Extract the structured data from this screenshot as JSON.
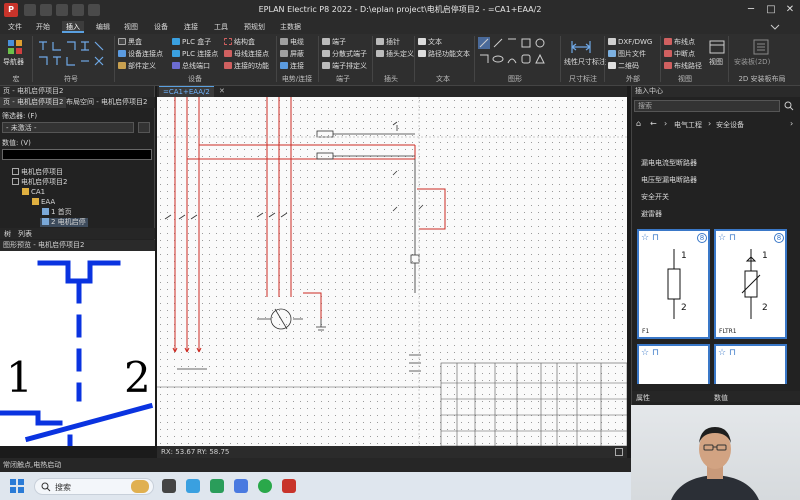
{
  "window": {
    "title": "EPLAN Electric P8 2022 - D:\\eplan project\\电机启停项目2 - =CA1+EAA/2",
    "minimize": "─",
    "maximize": "□",
    "close": "✕"
  },
  "app_icon_letter": "P",
  "menu": [
    "文件",
    "开始",
    "插入",
    "编辑",
    "视图",
    "设备",
    "连接",
    "工具",
    "预规划",
    "主数据"
  ],
  "menu_active": "插入",
  "ribbon": {
    "navigator": "导航器",
    "groups": {
      "macro": "宏",
      "symbol": "符号",
      "device": "设备",
      "potential": "电势/连接",
      "terminal": "端子",
      "plug": "插头",
      "text": "文本",
      "graphic": "图形",
      "dimension": "尺寸标注",
      "external": "外部",
      "view": "视图",
      "install_2d": "2D 安装板布局"
    },
    "device_col1": [
      "黑盒",
      "设备连接点",
      "部件定义"
    ],
    "device_col2": [
      "PLC 盒子",
      "PLC 连接点",
      "总线端口"
    ],
    "device_col3": [
      "结构盒",
      "母线连接点",
      "连接的功能"
    ],
    "potential": [
      "电缆",
      "屏蔽",
      "连接"
    ],
    "terminal": [
      "端子",
      "分散式端子",
      "端子排定义"
    ],
    "plug": [
      "插针",
      "插头定义"
    ],
    "text": [
      "文本",
      "路径功能文本"
    ],
    "dimension": "线性尺寸标注",
    "external": [
      "DXF/DWG",
      "图片文件",
      "二维码"
    ],
    "view_items": [
      "布线点",
      "中断点",
      "布线路径"
    ],
    "view": "视图",
    "install_2d": "安装板(2D)"
  },
  "left_panel": {
    "title": "页 - 电机启停项目2",
    "tabs": [
      "页 - 电机启停项目2",
      "布局空间 - 电机启停项目2"
    ],
    "filter_label": "筛选器: (F)",
    "filter_value": "- 未激活 -",
    "value_label": "数值: (V)",
    "tree": [
      "电机启停项目",
      "电机启停项目2",
      "CA1",
      "EAA",
      "1 首页",
      "2 电机启停"
    ],
    "bottom_tabs": [
      "树",
      "列表"
    ],
    "preview_title": "图形预览 - 电机启停项目2",
    "preview_labels": {
      "left": "1",
      "right": "2"
    }
  },
  "document_tab": "=CA1+EAA/2",
  "status": {
    "rx": "RX: 53.67",
    "ry": "RY: 58.75"
  },
  "right_panel": {
    "title": "插入中心",
    "search_placeholder": "搜索",
    "breadcrumb": [
      "电气工程",
      "安全设备"
    ],
    "categories": [
      "漏电电流型断路器",
      "电压型漏电断路器",
      "安全开关",
      "避雷器"
    ],
    "tiles": [
      {
        "name": "F1",
        "num_top": "1",
        "num_bottom": "2",
        "badge": "8"
      },
      {
        "name": "FLTR1",
        "num_top": "1",
        "num_bottom": "2",
        "badge": "8"
      }
    ],
    "bottom_tabs": [
      "属性",
      "数值"
    ]
  },
  "bottom_strip": "常闭触点,电热启动",
  "taskbar": {
    "search": "搜索"
  }
}
